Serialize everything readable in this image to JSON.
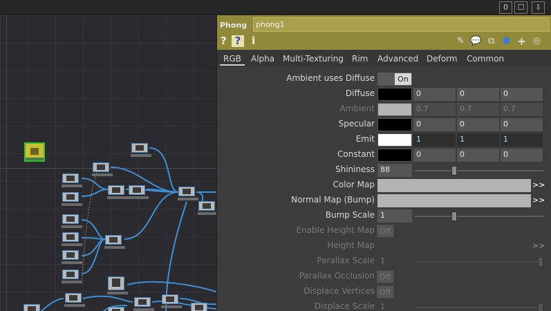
{
  "window": {
    "buttons": [
      "0",
      "☐",
      "⇩"
    ]
  },
  "network": {
    "selected_node": "phong1"
  },
  "panel": {
    "op_type": "Phong",
    "op_name": "phong1",
    "header_icons": [
      "?",
      "?",
      "i"
    ],
    "toolbar_icons": [
      "pencil-icon",
      "comment-icon",
      "clone-icon",
      "python-icon",
      "plus-icon",
      "target-icon"
    ],
    "tabs": [
      "RGB",
      "Alpha",
      "Multi-Texturing",
      "Rim",
      "Advanced",
      "Deform",
      "Common"
    ],
    "active_tab": "RGB",
    "params": {
      "ambient_uses_diffuse": {
        "label": "Ambient uses Diffuse",
        "value": "On"
      },
      "diffuse": {
        "label": "Diffuse",
        "color": "#000000",
        "r": "0",
        "g": "0",
        "b": "0"
      },
      "ambient": {
        "label": "Ambient",
        "color": "#b4b4b4",
        "r": "0.7",
        "g": "0.7",
        "b": "0.7"
      },
      "specular": {
        "label": "Specular",
        "color": "#000000",
        "r": "0",
        "g": "0",
        "b": "0"
      },
      "emit": {
        "label": "Emit",
        "color": "#ffffff",
        "r": "1",
        "g": "1",
        "b": "1"
      },
      "constant": {
        "label": "Constant",
        "color": "#000000",
        "r": "0",
        "g": "0",
        "b": "0"
      },
      "shininess": {
        "label": "Shininess",
        "value": "88",
        "fraction": 0.3
      },
      "color_map": {
        "label": "Color Map",
        "arrow": ">>"
      },
      "normal_map": {
        "label": "Normal Map (Bump)",
        "arrow": ">>"
      },
      "bump_scale": {
        "label": "Bump Scale",
        "value": "1",
        "fraction": 0.3
      },
      "enable_height_map": {
        "label": "Enable Height Map",
        "value": "Off"
      },
      "height_map": {
        "label": "Height Map",
        "arrow": ">>"
      },
      "parallax_scale": {
        "label": "Parallax Scale",
        "value": "1",
        "fraction": 1.0
      },
      "parallax_occlusion": {
        "label": "Parallax Occlusion",
        "value": "Off"
      },
      "displace_vertices": {
        "label": "Displace Vertices",
        "value": "Off"
      },
      "displace_scale": {
        "label": "Displace Scale",
        "value": "1",
        "fraction": 1.0
      }
    }
  }
}
